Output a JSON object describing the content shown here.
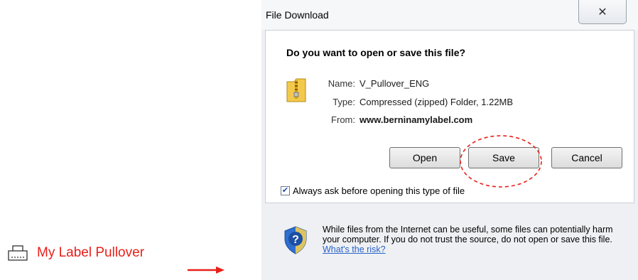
{
  "left_link": {
    "icon": "printer-icon",
    "label": "My Label Pullover"
  },
  "dialog": {
    "title": "File Download",
    "close_glyph": "✕",
    "question": "Do you want to open or save this file?",
    "file_icon": "zip-folder-icon",
    "info": {
      "name_label": "Name:",
      "name_value": "V_Pullover_ENG",
      "type_label": "Type:",
      "type_value": "Compressed (zipped) Folder, 1.22MB",
      "from_label": "From:",
      "from_value": "www.berninamylabel.com"
    },
    "buttons": {
      "open": "Open",
      "save": "Save",
      "cancel": "Cancel"
    },
    "checkbox": {
      "checked": true,
      "label": "Always ask before opening this type of file"
    },
    "warning": {
      "icon": "shield-question-icon",
      "text": "While files from the Internet can be useful, some files can potentially harm your computer. If you do not trust the source, do not open or save this file.",
      "link": "What's the risk?"
    }
  },
  "colors": {
    "link_red": "#e8201a",
    "highlight_red": "#e8201a",
    "link_blue": "#2a62c8"
  }
}
